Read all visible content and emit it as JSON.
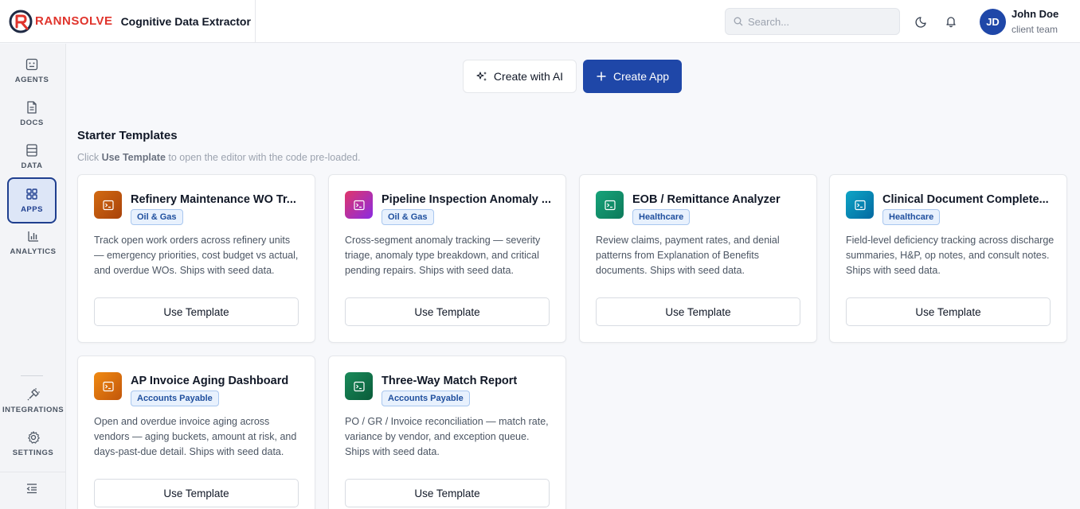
{
  "header": {
    "logo_text": "RANNSOLVE",
    "app_title": "Cognitive Data Extractor",
    "search_placeholder": "Search...",
    "user_initials": "JD",
    "user_name": "John Doe",
    "user_team": "client team"
  },
  "sidebar": {
    "items": [
      {
        "label": "AGENTS",
        "icon": "agent-icon"
      },
      {
        "label": "DOCS",
        "icon": "document-icon"
      },
      {
        "label": "DATA",
        "icon": "database-icon"
      },
      {
        "label": "APPS",
        "icon": "grid-icon",
        "active": true
      },
      {
        "label": "ANALYTICS",
        "icon": "bar-chart-icon"
      }
    ],
    "bottom_items": [
      {
        "label": "INTEGRATIONS",
        "icon": "plug-icon"
      },
      {
        "label": "SETTINGS",
        "icon": "gear-icon"
      }
    ]
  },
  "main": {
    "create_ai_label": "Create with AI",
    "create_app_label": "Create App",
    "section_title": "Starter Templates",
    "section_sub_prefix": "Click ",
    "section_sub_bold": "Use Template",
    "section_sub_suffix": " to open the editor with the code pre-loaded.",
    "use_template_label": "Use Template",
    "templates": [
      {
        "title": "Refinery Maintenance WO Tr...",
        "badge": "Oil & Gas",
        "desc": "Track open work orders across refinery units — emergency priorities, cost budget vs actual, and overdue WOs. Ships with seed data.",
        "color_from": "#d26a12",
        "color_to": "#a8420a"
      },
      {
        "title": "Pipeline Inspection Anomaly ...",
        "badge": "Oil & Gas",
        "desc": "Cross-segment anomaly tracking — severity triage, anomaly type breakdown, and critical pending repairs. Ships with seed data.",
        "color_from": "#e0366a",
        "color_to": "#8a2be2"
      },
      {
        "title": "EOB / Remittance Analyzer",
        "badge": "Healthcare",
        "desc": "Review claims, payment rates, and denial patterns from Explanation of Benefits documents. Ships with seed data.",
        "color_from": "#16a37a",
        "color_to": "#0d7a5a"
      },
      {
        "title": "Clinical Document Complete...",
        "badge": "Healthcare",
        "desc": "Field-level deficiency tracking across discharge summaries, H&P, op notes, and consult notes. Ships with seed data.",
        "color_from": "#0ea5c6",
        "color_to": "#0369a1"
      },
      {
        "title": "AP Invoice Aging Dashboard",
        "badge": "Accounts Payable",
        "desc": "Open and overdue invoice aging across vendors — aging buckets, amount at risk, and days-past-due detail. Ships with seed data.",
        "color_from": "#f08a12",
        "color_to": "#c2560a"
      },
      {
        "title": "Three-Way Match Report",
        "badge": "Accounts Payable",
        "desc": "PO / GR / Invoice reconciliation — match rate, variance by vendor, and exception queue. Ships with seed data.",
        "color_from": "#1a8a5a",
        "color_to": "#0a5c3a"
      }
    ]
  }
}
